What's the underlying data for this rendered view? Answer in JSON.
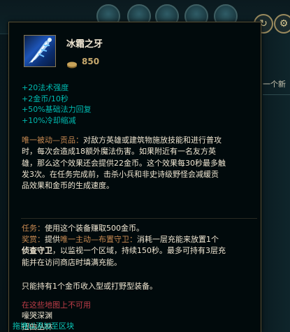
{
  "background": {
    "right_text": "一个新"
  },
  "item": {
    "name": "冰霜之牙",
    "icon": "frost-fang-icon",
    "gold_icon": "gold-coins-icon",
    "price": "850",
    "stats": [
      "+20法术强度",
      "+2金币/10秒",
      "+50%基础法力回复",
      "+10%冷却缩减"
    ],
    "passive": {
      "label": "唯一被动—贡品：",
      "lines": [
        "对敌方英雄或建筑物施放技能和进行普攻",
        "时，每次会造成18额外魔法伤害。如果附近有一名友方英",
        "雄，那么这个效果还会提供22金币。这个效果每30秒最多触",
        "发3次。在任务完成前，击杀小兵和非史诗级野怪会减缓贡",
        "品效果和金币的生成速度。"
      ]
    },
    "quest": {
      "label": "任务：",
      "text": "使用这个装备赚取500金币。"
    },
    "active": {
      "label": "奖赏：",
      "line1_prefix": "提供",
      "line1_label": "唯一主动—布置守卫：",
      "line1_rest": "消耗一层充能来放置1个",
      "line2_bold": "侦查守卫",
      "line2_rest": "，以监视一个区域，持续150秒。最多可持有3层充",
      "line3": "能并在访问商店时填满充能。"
    },
    "note": "只能持有1个金币收入型或打野型装备。",
    "unavailable_label": "在这些地图上不可用",
    "maps": [
      "嚎哭深渊",
      "扭曲丛林"
    ],
    "drag_hint": "拖拽以添加至区块"
  },
  "colors": {
    "stat": "#00b9b0",
    "gold": "#c8aa6e",
    "orange_label": "#c88a52",
    "unavailable": "#bf3d48",
    "hint": "#0ac8b9",
    "border": "#5a4f33"
  }
}
